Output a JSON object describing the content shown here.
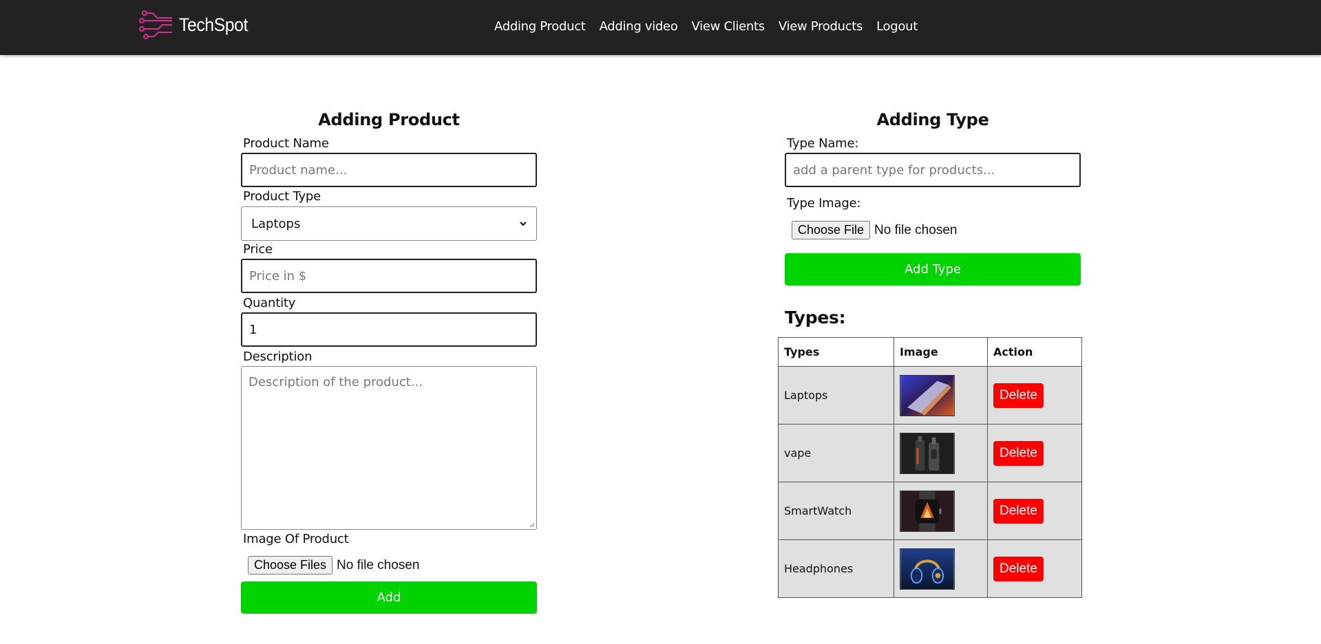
{
  "brand": {
    "name": "TechSpot"
  },
  "nav": {
    "items": [
      "Adding Product",
      "Adding video",
      "View Clients",
      "View Products",
      "Logout"
    ]
  },
  "product_form": {
    "title": "Adding Product",
    "name_label": "Product Name",
    "name_placeholder": "Product name...",
    "type_label": "Product Type",
    "type_selected": "Laptops",
    "price_label": "Price",
    "price_placeholder": "Price in $",
    "quantity_label": "Quantity",
    "quantity_value": "1",
    "description_label": "Description",
    "description_placeholder": "Description of the product...",
    "image_label": "Image Of Product",
    "file_button": "Choose Files",
    "file_status": "No file chosen",
    "submit_label": "Add"
  },
  "type_form": {
    "title": "Adding Type",
    "name_label": "Type Name:",
    "name_placeholder": "add a parent type for products...",
    "image_label": "Type Image:",
    "file_button": "Choose File",
    "file_status": "No file chosen",
    "submit_label": "Add Type"
  },
  "types_list": {
    "heading": "Types:",
    "columns": [
      "Types",
      "Image",
      "Action"
    ],
    "rows": [
      {
        "type": "Laptops",
        "image": "laptop-image",
        "action": "Delete"
      },
      {
        "type": "vape",
        "image": "vape-image",
        "action": "Delete"
      },
      {
        "type": "SmartWatch",
        "image": "smartwatch-image",
        "action": "Delete"
      },
      {
        "type": "Headphones",
        "image": "headphones-image",
        "action": "Delete"
      }
    ]
  },
  "colors": {
    "navbar": "#222222",
    "brand_accent": "#e0279a",
    "primary_button": "#00d400",
    "delete_button": "#ff0000",
    "table_cell": "#e0e0e0"
  }
}
